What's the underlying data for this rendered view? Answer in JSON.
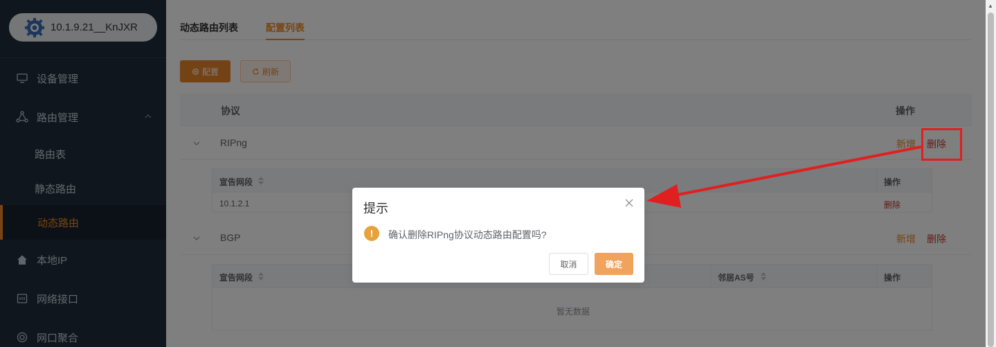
{
  "device": {
    "label": "10.1.9.21__KnJXR"
  },
  "sidebar": {
    "items": [
      {
        "label": "设备管理"
      },
      {
        "label": "路由管理"
      },
      {
        "label": "路由表"
      },
      {
        "label": "静态路由"
      },
      {
        "label": "动态路由"
      },
      {
        "label": "本地IP"
      },
      {
        "label": "网络接口"
      },
      {
        "label": "网口聚合"
      }
    ]
  },
  "tabs": [
    {
      "label": "动态路由列表"
    },
    {
      "label": "配置列表"
    }
  ],
  "toolbar": {
    "config": "配置",
    "refresh": "刷新"
  },
  "table": {
    "headers": {
      "protocol": "协议",
      "action": "操作"
    },
    "rows": [
      {
        "name": "RIPng",
        "add": "新增",
        "del": "删除",
        "sub": {
          "col1": "宣告网段",
          "col_action": "操作",
          "cell1": "10.1.2.1",
          "cell_action": "删除"
        }
      },
      {
        "name": "BGP",
        "add": "新增",
        "del": "删除",
        "sub": {
          "col1": "宣告网段",
          "col_neighbor": "邻居AS号",
          "col_action": "操作",
          "empty": "暂无数据"
        }
      }
    ]
  },
  "dialog": {
    "title": "提示",
    "message": "确认删除RIPng协议动态路由配置吗?",
    "cancel": "取消",
    "ok": "确定"
  },
  "colors": {
    "accent": "#f08a24",
    "danger": "#c0392b",
    "annotation": "#e02020"
  }
}
